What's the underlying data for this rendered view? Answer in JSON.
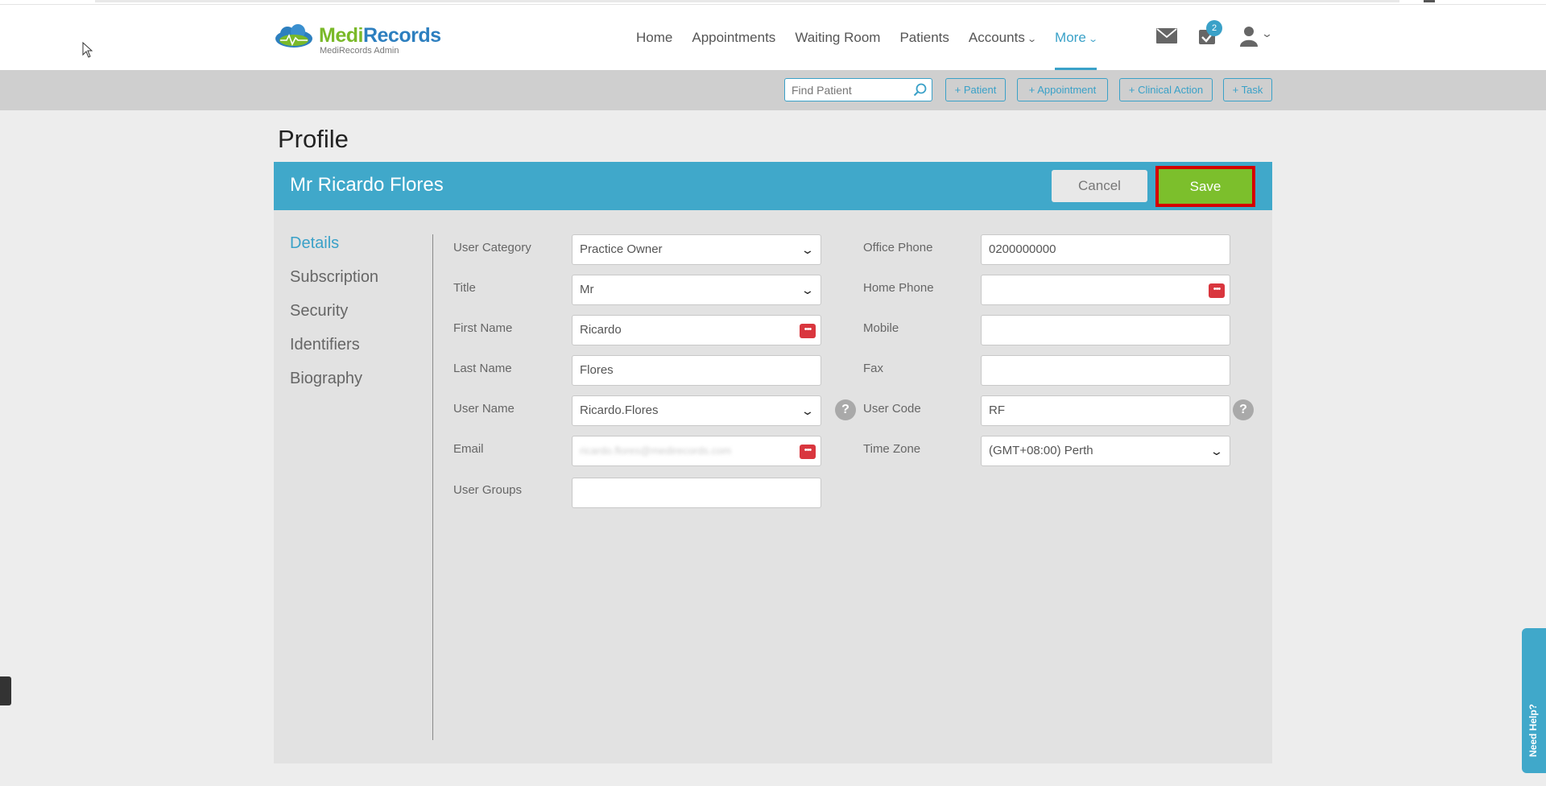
{
  "brand": {
    "name_part1": "Medi",
    "name_part2": "Records",
    "subtitle": "MediRecords Admin"
  },
  "nav": {
    "items": [
      {
        "label": "Home"
      },
      {
        "label": "Appointments"
      },
      {
        "label": "Waiting Room"
      },
      {
        "label": "Patients"
      },
      {
        "label": "Accounts"
      },
      {
        "label": "More"
      }
    ],
    "active": "More",
    "task_badge": "2"
  },
  "toolbar": {
    "find_placeholder": "Find Patient",
    "add_patient": "+ Patient",
    "add_appointment": "+ Appointment",
    "add_clinical_action": "+ Clinical Action",
    "add_task": "+ Task"
  },
  "page": {
    "title": "Profile"
  },
  "profile": {
    "display_name": "Mr Ricardo Flores",
    "cancel_label": "Cancel",
    "save_label": "Save"
  },
  "sidenav": {
    "items": [
      {
        "label": "Details"
      },
      {
        "label": "Subscription"
      },
      {
        "label": "Security"
      },
      {
        "label": "Identifiers"
      },
      {
        "label": "Biography"
      }
    ],
    "active": "Details"
  },
  "form": {
    "user_category": {
      "label": "User Category",
      "value": "Practice Owner"
    },
    "title": {
      "label": "Title",
      "value": "Mr"
    },
    "first_name": {
      "label": "First Name",
      "value": "Ricardo"
    },
    "last_name": {
      "label": "Last Name",
      "value": "Flores"
    },
    "user_name": {
      "label": "User Name",
      "value": "Ricardo.Flores"
    },
    "email": {
      "label": "Email",
      "value": "ricardo.flores@medirecords.com"
    },
    "user_groups": {
      "label": "User Groups",
      "value": ""
    },
    "office_phone": {
      "label": "Office Phone",
      "value": "0200000000"
    },
    "home_phone": {
      "label": "Home Phone",
      "value": ""
    },
    "mobile": {
      "label": "Mobile",
      "value": ""
    },
    "fax": {
      "label": "Fax",
      "value": ""
    },
    "user_code": {
      "label": "User Code",
      "value": "RF"
    },
    "time_zone": {
      "label": "Time Zone",
      "value": "(GMT+08:00) Perth"
    }
  },
  "help_widget": {
    "label": "Need Help?"
  },
  "colors": {
    "accent": "#40a8ca",
    "save": "#7cbf2c",
    "highlight": "#d40000",
    "alert": "#d9363e"
  }
}
